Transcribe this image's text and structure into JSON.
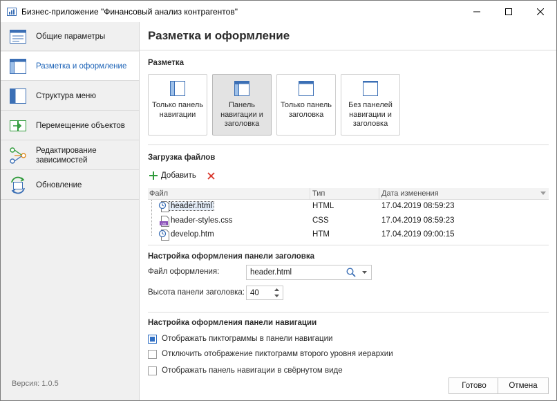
{
  "window": {
    "title": "Бизнес-приложение \"Финансовый анализ контрагентов\""
  },
  "sidebar": {
    "items": [
      {
        "label": "Общие параметры",
        "icon": "general-settings-icon",
        "active": false
      },
      {
        "label": "Разметка и оформление",
        "icon": "layout-icon",
        "active": true
      },
      {
        "label": "Структура меню",
        "icon": "menu-structure-icon",
        "active": false
      },
      {
        "label": "Перемещение объектов",
        "icon": "move-objects-icon",
        "active": false
      },
      {
        "label": "Редактирование зависимостей",
        "icon": "dependencies-icon",
        "active": false
      },
      {
        "label": "Обновление",
        "icon": "refresh-icon",
        "active": false
      }
    ],
    "version": "Версия: 1.0.5"
  },
  "main": {
    "title": "Разметка и оформление",
    "layout_section": {
      "title": "Разметка",
      "options": [
        {
          "label": "Только панель навигации",
          "selected": false
        },
        {
          "label": "Панель навигации и заголовка",
          "selected": true
        },
        {
          "label": "Только панель заголовка",
          "selected": false
        },
        {
          "label": "Без панелей навигации и заголовка",
          "selected": false
        }
      ]
    },
    "files_section": {
      "title": "Загрузка файлов",
      "add_label": "Добавить",
      "columns": [
        "Файл",
        "Тип",
        "Дата изменения"
      ],
      "rows": [
        {
          "name": "header.html",
          "type": "HTML",
          "date": "17.04.2019 08:59:23",
          "icon": "html-file-icon",
          "selected": true
        },
        {
          "name": "header-styles.css",
          "type": "CSS",
          "date": "17.04.2019 08:59:23",
          "icon": "css-file-icon",
          "selected": false
        },
        {
          "name": "develop.htm",
          "type": "HTM",
          "date": "17.04.2019 09:00:15",
          "icon": "html-file-icon",
          "selected": false
        }
      ]
    },
    "header_panel": {
      "title": "Настройка оформления панели заголовка",
      "file_label": "Файл оформления:",
      "file_value": "header.html",
      "height_label": "Высота панели заголовка:",
      "height_value": "40"
    },
    "nav_panel": {
      "title": "Настройка оформления панели навигации",
      "options": [
        {
          "label": "Отображать пиктограммы в панели навигации",
          "checked": true
        },
        {
          "label": "Отключить отображение пиктограмм второго уровня иерархии",
          "checked": false
        },
        {
          "label": "Отображать панель навигации в свёрнутом виде",
          "checked": false
        }
      ]
    },
    "buttons": {
      "ok": "Готово",
      "cancel": "Отмена"
    }
  },
  "colors": {
    "accent": "#1c63b7",
    "sidebar_bg": "#f0f0f0",
    "add_green": "#2e9a3a",
    "delete_red": "#d9362b"
  }
}
